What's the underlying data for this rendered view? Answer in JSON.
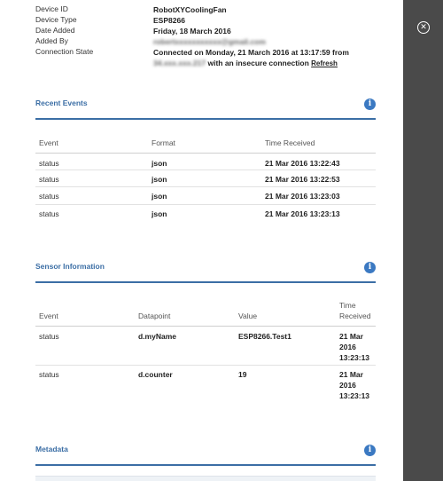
{
  "device": {
    "rows": [
      {
        "label": "Device ID",
        "value": "RobotXYCoolingFan"
      },
      {
        "label": "Device Type",
        "value": "ESP8266"
      },
      {
        "label": "Date Added",
        "value": "Friday, 18 March 2016"
      },
      {
        "label": "Added By",
        "value": "robertxxxxxxxxxxx@gmail.com"
      },
      {
        "label": "Connection State",
        "value": "Connected on Monday, 21 March 2016 at 13:17:59 from"
      }
    ],
    "connection_ip": "34.xxx.xxx.217",
    "connection_suffix": "with an insecure connection",
    "refresh_label": "Refresh"
  },
  "recent_events": {
    "title": "Recent Events",
    "headers": [
      "Event",
      "Format",
      "Time Received"
    ],
    "rows": [
      [
        "status",
        "json",
        "21 Mar 2016 13:22:43"
      ],
      [
        "status",
        "json",
        "21 Mar 2016 13:22:53"
      ],
      [
        "status",
        "json",
        "21 Mar 2016 13:23:03"
      ],
      [
        "status",
        "json",
        "21 Mar 2016 13:23:13"
      ]
    ]
  },
  "sensor_info": {
    "title": "Sensor Information",
    "headers": [
      "Event",
      "Datapoint",
      "Value",
      "Time",
      "Received"
    ],
    "rows": [
      [
        "status",
        "d.myName",
        "ESP8266.Test1",
        "21 Mar",
        "2016",
        "13:23:13"
      ],
      [
        "status",
        "d.counter",
        "19",
        "21 Mar",
        "2016",
        "13:23:13"
      ]
    ]
  },
  "metadata": {
    "title": "Metadata"
  },
  "icons": {
    "info": "i",
    "close": "✕"
  },
  "colors": {
    "accent": "#3b6ea5",
    "overlay": "#4a4a4a"
  }
}
